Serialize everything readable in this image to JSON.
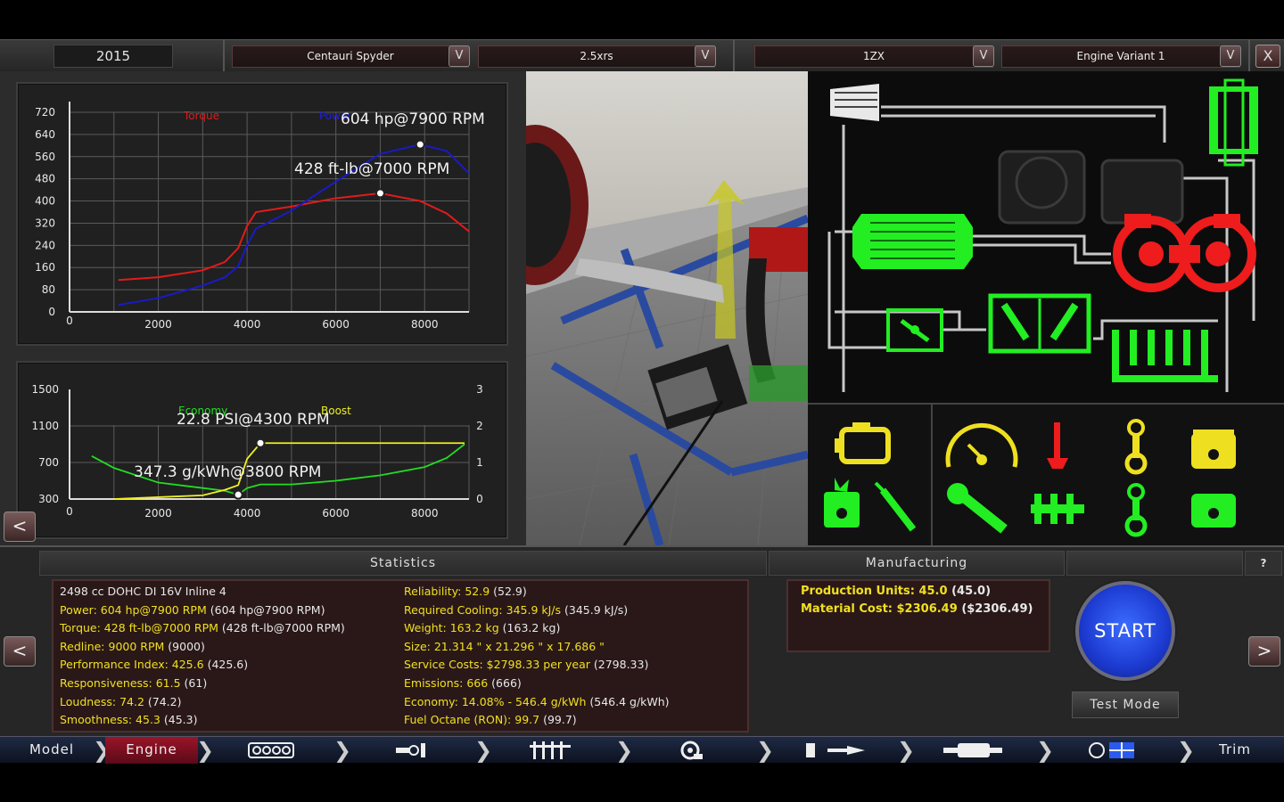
{
  "topbar": {
    "year": "2015",
    "model_select": "Centauri Spyder",
    "trim_select": "2.5xrs",
    "family_select": "1ZX",
    "variant_select": "Engine Variant 1",
    "arrow_glyph": "V",
    "close_glyph": "X"
  },
  "left_panel": {
    "back_glyph": "<"
  },
  "power_chart": {
    "legend_torque": "Torque",
    "legend_power": "Power",
    "peak_power_label": "604 hp@7900 RPM",
    "peak_torque_label": "428 ft-lb@7000 RPM"
  },
  "economy_chart": {
    "legend_economy": "Economy",
    "legend_boost": "Boost",
    "boost_label": "22.8 PSI@4300 RPM",
    "economy_label": "347.3 g/kWh@3800 RPM"
  },
  "chart_data": [
    {
      "type": "line",
      "x": [
        1100,
        2000,
        3000,
        3500,
        3800,
        4000,
        4200,
        5000,
        6000,
        7000,
        7900,
        8500,
        9000
      ],
      "series": [
        {
          "name": "Torque",
          "color": "#e21b1b",
          "values": [
            115,
            125,
            150,
            180,
            230,
            310,
            360,
            380,
            410,
            428,
            400,
            355,
            290
          ]
        },
        {
          "name": "Power",
          "color": "#1a1ac8",
          "values": [
            25,
            50,
            95,
            125,
            165,
            240,
            300,
            365,
            470,
            570,
            604,
            580,
            500
          ]
        }
      ],
      "xticks": [
        "0",
        "2000",
        "4000",
        "6000",
        "8000"
      ],
      "yticks": [
        "0",
        "80",
        "160",
        "240",
        "320",
        "400",
        "480",
        "560",
        "640",
        "720"
      ],
      "xlim": [
        0,
        9000
      ],
      "ylim": [
        0,
        720
      ],
      "grid": true,
      "markers": [
        {
          "x": 7900,
          "y": 604
        },
        {
          "x": 7000,
          "y": 428
        }
      ]
    },
    {
      "type": "line",
      "x": [
        500,
        1000,
        2000,
        3000,
        3500,
        3800,
        4000,
        4300,
        5000,
        6000,
        7000,
        8000,
        8500,
        8900
      ],
      "series": [
        {
          "name": "Economy",
          "color": "#22dd22",
          "axis": "left",
          "values": [
            770,
            640,
            480,
            420,
            390,
            347,
            420,
            460,
            460,
            500,
            560,
            650,
            750,
            900
          ]
        },
        {
          "name": "Boost",
          "color": "#f0f020",
          "axis": "right",
          "values": [
            null,
            0,
            0.05,
            0.1,
            0.25,
            0.38,
            1.1,
            1.53,
            1.53,
            1.53,
            1.53,
            1.53,
            1.53,
            1.53
          ]
        }
      ],
      "xticks": [
        "0",
        "2000",
        "4000",
        "6000",
        "8000"
      ],
      "yticks_left": [
        "300",
        "700",
        "1100",
        "1500"
      ],
      "yticks_right": [
        "0",
        "1",
        "2",
        "3"
      ],
      "xlim": [
        0,
        9000
      ],
      "ylim_left": [
        300,
        1500
      ],
      "ylim_right": [
        0,
        3
      ],
      "grid": true,
      "markers": [
        {
          "x": 4300,
          "y_right": 1.53
        },
        {
          "x": 3800,
          "y": 347
        }
      ]
    }
  ],
  "bottom": {
    "statistics_header": "Statistics",
    "manufacturing_header": "Manufacturing",
    "help_glyph": "?",
    "prev_glyph": "<",
    "next_glyph": ">",
    "stats_left": [
      {
        "label": "",
        "value": "2498 cc DOHC DI 16V Inline 4"
      },
      {
        "label": "Power: 604 hp@7900 RPM",
        "value": "(604 hp@7900 RPM)"
      },
      {
        "label": "Torque: 428 ft-lb@7000 RPM",
        "value": "(428 ft-lb@7000 RPM)"
      },
      {
        "label": "Redline: 9000 RPM",
        "value": "(9000)"
      },
      {
        "label": "Performance Index: 425.6",
        "value": "(425.6)"
      },
      {
        "label": "Responsiveness: 61.5",
        "value": "(61)"
      },
      {
        "label": "Loudness: 74.2",
        "value": "(74.2)"
      },
      {
        "label": "Smoothness: 45.3",
        "value": "(45.3)"
      }
    ],
    "stats_right": [
      {
        "label": "Reliability: 52.9",
        "value": "(52.9)"
      },
      {
        "label": "Required Cooling: 345.9 kJ/s",
        "value": "(345.9 kJ/s)"
      },
      {
        "label": "Weight: 163.2 kg",
        "value": "(163.2 kg)"
      },
      {
        "label": "Size: 21.314 \" x 21.296 \" x 17.686 \"",
        "value": ""
      },
      {
        "label": "Service Costs: $2798.33 per year",
        "value": "(2798.33)"
      },
      {
        "label": "Emissions: 666",
        "value": "(666)"
      },
      {
        "label": "Economy: 14.08% - 546.4 g/kWh",
        "value": "(546.4 g/kWh)"
      },
      {
        "label": "Fuel Octane (RON): 99.7",
        "value": "(99.7)"
      }
    ],
    "manufacturing": [
      {
        "label": "Production Units: 45.0",
        "value": "(45.0)"
      },
      {
        "label": "Material Cost: $2306.49",
        "value": "($2306.49)"
      }
    ],
    "start_label": "START",
    "test_mode_label": "Test Mode"
  },
  "nav": {
    "model": "Model",
    "engine": "Engine",
    "trim": "Trim",
    "chevron": "❯"
  },
  "colors": {
    "accent_yellow": "#f0e020",
    "schematic_green": "#22ee22",
    "schematic_red": "#ee1c1c",
    "start_blue": "#1c3ad0",
    "active_nav_red": "#8a1020"
  },
  "icons": [
    "engine-block-icon",
    "crankshaft-icon",
    "bottom-end-icon",
    "top-end-icon",
    "turbo-icon",
    "fuel-system-icon",
    "exhaust-icon",
    "tune-icon",
    "check-engine-icon",
    "gauge-icon",
    "valve-icon",
    "conrod-icon",
    "piston-icon",
    "intercooler-icon",
    "throttle-icon",
    "intake-manifold-icon",
    "exhaust-manifold-icon",
    "air-filter-icon"
  ]
}
